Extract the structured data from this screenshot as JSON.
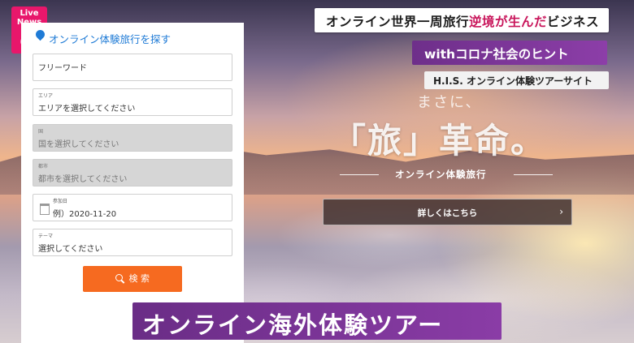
{
  "logo": {
    "line1": "Live",
    "line2": "News",
    "symbol": "α",
    "color": "#e8176b"
  },
  "panel": {
    "title": "オンライン体験旅行を探す",
    "fields": [
      {
        "label": "",
        "value": "フリーワード"
      },
      {
        "label": "エリア",
        "value": "エリアを選択してください"
      },
      {
        "label": "国",
        "value": "国を選択してください"
      },
      {
        "label": "都市",
        "value": "都市を選択してください"
      },
      {
        "label": "参加日",
        "value": "例）2020-11-20"
      },
      {
        "label": "テーマ",
        "value": "選択してください"
      }
    ],
    "search_label": "検 索",
    "search_color": "#f66a20"
  },
  "headlines": {
    "h1_prefix": "オンライン世界一周旅行",
    "h1_highlight": "逆境が生んだ",
    "h1_suffix": "ビジネス",
    "h2": "withコロナ社会のヒント",
    "h3": "H.I.S. オンライン体験ツアーサイト"
  },
  "hero": {
    "small": "まさに、",
    "big": "「旅」革命。",
    "sub": "オンライン体験旅行",
    "button": "詳しくはこちら",
    "button_arrow": "›"
  },
  "caption": "オンライン海外体験ツアー"
}
